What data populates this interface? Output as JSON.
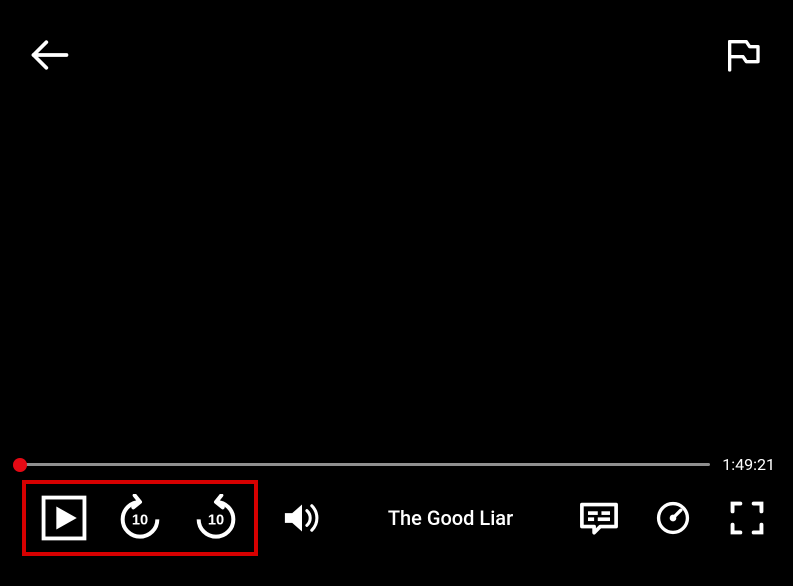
{
  "header": {
    "back_icon": "back-arrow-icon",
    "flag_icon": "flag-icon"
  },
  "player": {
    "title": "The Good Liar",
    "remaining_time": "1:49:21",
    "progress_percent": "0.6"
  },
  "controls": {
    "play": "play-icon",
    "rewind_seconds": "10",
    "forward_seconds": "10",
    "volume_icon": "volume-icon",
    "subtitles_icon": "subtitles-icon",
    "speed_icon": "playback-speed-icon",
    "fullscreen_icon": "fullscreen-icon"
  }
}
